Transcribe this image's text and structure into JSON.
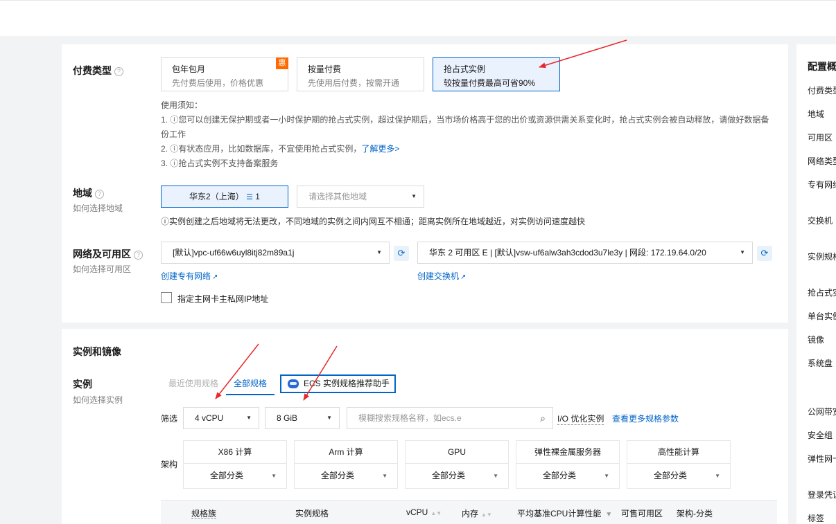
{
  "billing": {
    "label": "付费类型",
    "cards": [
      {
        "title": "包年包月",
        "desc": "先付费后使用，价格优惠",
        "badge": "惠"
      },
      {
        "title": "按量付费",
        "desc": "先使用后付费，按需开通"
      },
      {
        "title": "抢占式实例",
        "desc": "较按量付费最高可省90%"
      }
    ],
    "notes_title": "使用须知：",
    "notes": [
      "1. ⓘ您可以创建无保护期或者一小时保护期的抢占式实例，超过保护期后，当市场价格高于您的出价或资源供需关系变化时，抢占式实例会被自动释放，请做好数据备",
      "份工作",
      "2. ⓘ有状态应用，比如数据库，不宜使用抢占式实例，",
      "3. ⓘ抢占式实例不支持备案服务"
    ],
    "learn_more": "了解更多>"
  },
  "region": {
    "label": "地域",
    "sublabel": "如何选择地域",
    "selected": "华东2（上海）",
    "count": "1",
    "other_placeholder": "请选择其他地域",
    "note": "ⓘ实例创建之后地域将无法更改，不同地域的实例之间内网互不相通；距离实例所在地域越近，对实例访问速度越快"
  },
  "network": {
    "label": "网络及可用区",
    "sublabel": "如何选择可用区",
    "vpc": "[默认]vpc-uf66w6uyl8itj82m89a1j",
    "vswitch": "华东 2 可用区 E | [默认]vsw-uf6alw3ah3cdod3u7le3y | 网段: 172.19.64.0/20",
    "create_vpc": "创建专有网络",
    "create_vswitch": "创建交换机",
    "checkbox_label": "指定主网卡主私网IP地址"
  },
  "instance_section": {
    "title": "实例和镜像",
    "label": "实例",
    "sublabel": "如何选择实例",
    "tabs": [
      "最近使用规格",
      "全部规格"
    ],
    "assistant": "ECS 实例规格推荐助手",
    "filter_label": "筛选",
    "vcpu": "4 vCPU",
    "memory": "8 GiB",
    "search_placeholder": "模糊搜索规格名称，如ecs.e",
    "io_label": "I/O 优化实例",
    "more_params": "查看更多规格参数",
    "arch_label": "架构",
    "archs": [
      "X86 计算",
      "Arm 计算",
      "GPU",
      "弹性裸金属服务器",
      "高性能计算"
    ],
    "arch_sub": "全部分类",
    "table_headers": [
      "规格族",
      "实例规格",
      "vCPU",
      "内存",
      "平均基准CPU计算性能",
      "可售可用区",
      "架构-分类"
    ]
  },
  "sidebar": {
    "title": "配置概",
    "items": [
      "付费类型",
      "地域",
      "可用区",
      "网络类型",
      "专有网络",
      "交换机",
      "实例规格",
      "抢占式实",
      "单台实例",
      "镜像",
      "系统盘",
      "公网带宽",
      "安全组",
      "弹性网卡",
      "登录凭证",
      "标签"
    ]
  },
  "colors": {
    "accent": "#0064c8",
    "badge": "#ff6a00",
    "annotation": "#e8262b"
  }
}
